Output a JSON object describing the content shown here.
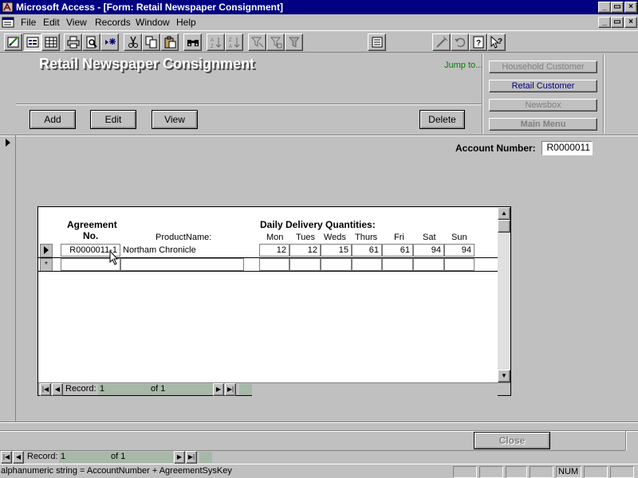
{
  "window": {
    "title": "Microsoft Access - [Form: Retail Newspaper Consignment]",
    "minimize_glyph": "_",
    "restore_glyph": "▭",
    "close_glyph": "×"
  },
  "menu": {
    "items": [
      {
        "label": "File",
        "accel": "F"
      },
      {
        "label": "Edit",
        "accel": "E"
      },
      {
        "label": "View",
        "accel": "V"
      },
      {
        "label": "Records",
        "accel": "R"
      },
      {
        "label": "Window",
        "accel": "W"
      },
      {
        "label": "Help",
        "accel": "H"
      }
    ]
  },
  "toolbar": {
    "icons": [
      "design-view-icon",
      "form-view-icon",
      "datasheet-view-icon",
      "print-icon",
      "print-preview-icon",
      "new-record-icon",
      "cut-icon",
      "copy-icon",
      "paste-icon",
      "find-icon",
      "sort-ascending-icon",
      "sort-descending-icon",
      "filter-by-selection-icon",
      "filter-by-form-icon",
      "apply-filter-icon",
      "properties-icon",
      "build-icon",
      "undo-icon",
      "help-icon",
      "whats-this-icon"
    ]
  },
  "form": {
    "title": "Retail Newspaper Consignment",
    "jump_to_label": "Jump to...",
    "nav_buttons": [
      {
        "label": "Household Customer",
        "enabled": false
      },
      {
        "label": "Retail Customer",
        "enabled": true
      },
      {
        "label": "Newsbox",
        "enabled": false
      },
      {
        "label": "Main Menu",
        "enabled": false
      }
    ],
    "buttons": {
      "add": "Add",
      "edit": "Edit",
      "view": "View",
      "delete": "Delete",
      "close": "Close"
    },
    "account_number_label": "Account Number:",
    "account_number_value": "R0000011"
  },
  "subform": {
    "headers": {
      "agreement_line1": "Agreement",
      "agreement_line2": "No.",
      "product": "ProductName:",
      "daily_title": "Daily Delivery Quantities:",
      "days": [
        "Mon",
        "Tues",
        "Weds",
        "Thurs",
        "Fri",
        "Sat",
        "Sun"
      ]
    },
    "rows": [
      {
        "agreement_no": "R0000011-1",
        "product": "Northam Chronicle",
        "qty": [
          "12",
          "12",
          "15",
          "61",
          "61",
          "94",
          "94"
        ]
      }
    ],
    "new_row_marker": "*",
    "current_row_marker": "▶",
    "record_nav": {
      "label": "Record:",
      "current": "1",
      "of_label": "of",
      "total": "1"
    }
  },
  "main_record_nav": {
    "label": "Record:",
    "current": "1",
    "of_label": "of",
    "total": "1"
  },
  "status_bar": {
    "message": "alphanumeric string = AccountNumber + AgreementSysKey",
    "num_indicator": "NUM"
  }
}
